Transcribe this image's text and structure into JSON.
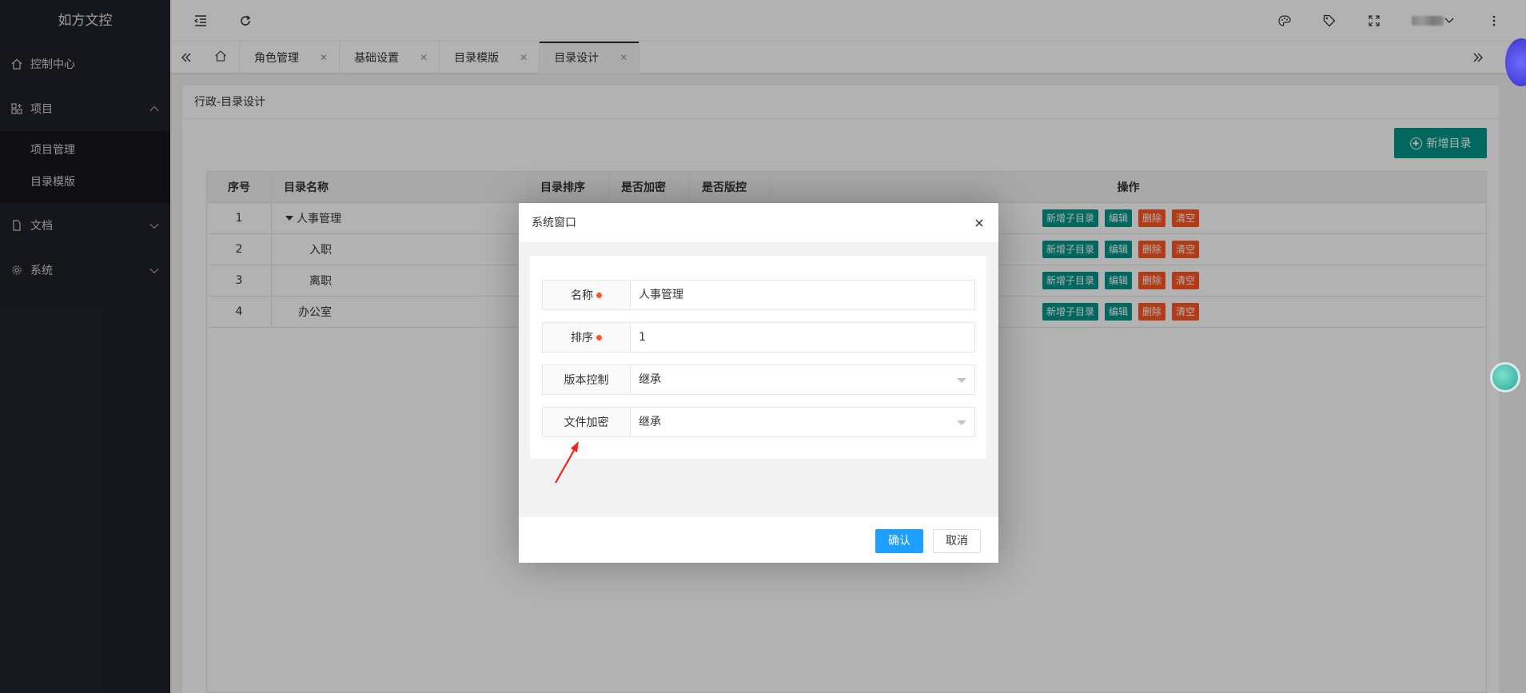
{
  "app": {
    "logo": "如方文控"
  },
  "sidebar": {
    "items": [
      {
        "label": "控制中心",
        "icon": "home-icon"
      },
      {
        "label": "项目",
        "icon": "apps-icon",
        "expanded": true,
        "children": [
          {
            "label": "项目管理"
          },
          {
            "label": "目录模版"
          }
        ]
      },
      {
        "label": "文档",
        "icon": "file-icon"
      },
      {
        "label": "系统",
        "icon": "gear-icon"
      }
    ]
  },
  "tabs": [
    {
      "label": "角色管理"
    },
    {
      "label": "基础设置"
    },
    {
      "label": "目录模版"
    },
    {
      "label": "目录设计",
      "active": true
    }
  ],
  "page": {
    "title": "行政-目录设计",
    "add_button": "新增目录"
  },
  "table": {
    "headers": [
      "序号",
      "目录名称",
      "目录排序",
      "是否加密",
      "是否版控",
      "操作"
    ],
    "rows": [
      {
        "no": "1",
        "name": "人事管理",
        "expandable": true
      },
      {
        "no": "2",
        "name": "入职"
      },
      {
        "no": "3",
        "name": "离职"
      },
      {
        "no": "4",
        "name": "办公室"
      }
    ],
    "actions": [
      "新增子目录",
      "编辑",
      "删除",
      "清空"
    ]
  },
  "modal": {
    "title": "系统窗口",
    "fields": [
      {
        "label": "名称",
        "required": true,
        "value": "人事管理"
      },
      {
        "label": "排序",
        "required": true,
        "value": "1"
      },
      {
        "label": "版本控制",
        "required": false,
        "value": "继承",
        "select": true
      },
      {
        "label": "文件加密",
        "required": false,
        "value": "继承",
        "select": true
      }
    ],
    "confirm": "确认",
    "cancel": "取消"
  },
  "colors": {
    "sidebar_bg": "#20222a",
    "teal": "#009688",
    "orange_red": "#ff5722",
    "blue": "#1e9fff"
  }
}
